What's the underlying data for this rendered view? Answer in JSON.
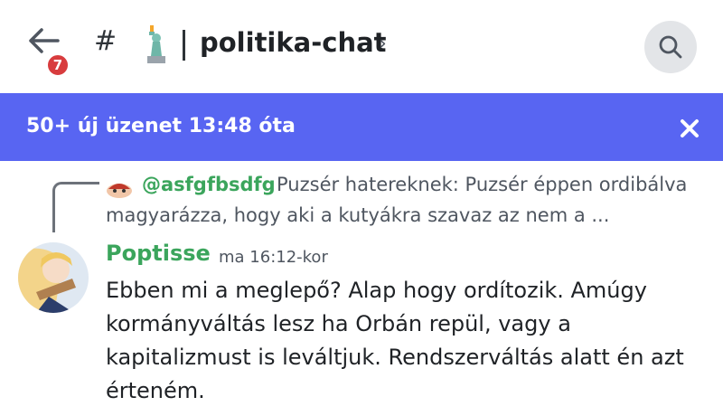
{
  "header": {
    "unread_count": "7",
    "hash": "#",
    "channel_emoji": "statue-of-liberty",
    "channel_name": "politika-chat",
    "chevron": "›"
  },
  "banner": {
    "text": "50+ új üzenet 13:48 óta",
    "background": "#5865f2"
  },
  "reply": {
    "author": "@asfgfbsdfg",
    "text_line1": "Puzsér hatereknek: Puzsér éppen ordibálva",
    "text_line2": "magyarázza, hogy aki a kutyákra szavaz az nem a ..."
  },
  "message": {
    "author": "Poptisse",
    "timestamp": "ma 16:12-kor",
    "lines": [
      "Ebben mi a meglepő? Alap hogy ordítozik. Amúgy",
      "kormányváltás lesz ha Orbán repül, vagy a",
      "kapitalizmust is leváltjuk. Rendszerváltás alatt én azt",
      "érteném."
    ]
  },
  "colors": {
    "username_green": "#3ba55c",
    "badge_red": "#d83c3e"
  }
}
